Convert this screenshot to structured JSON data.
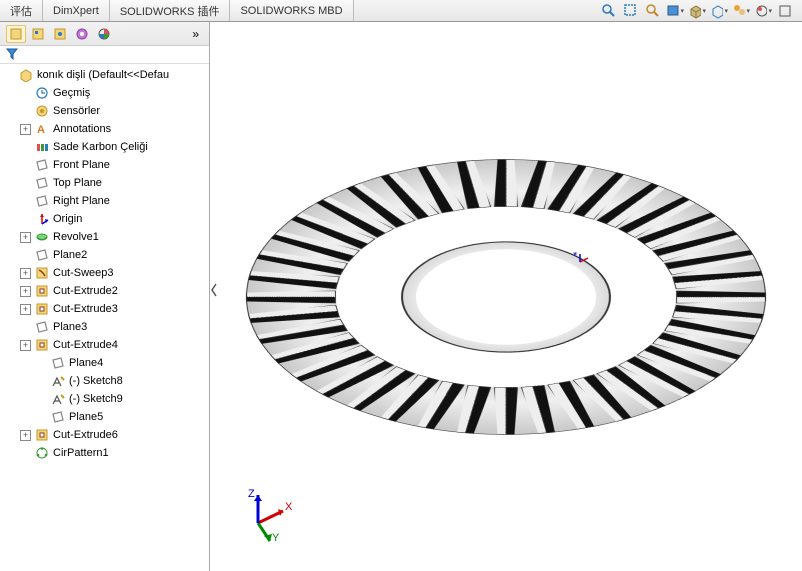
{
  "tabs": [
    "评估",
    "DimXpert",
    "SOLIDWORKS 插件",
    "SOLIDWORKS MBD"
  ],
  "toolbar_icons": [
    "zoom-fit",
    "zoom-area",
    "zoom-prev",
    "section-view",
    "view-orient",
    "display-style",
    "hide-show",
    "scene",
    "render"
  ],
  "sidebar_tab_icons": [
    "feature-tree",
    "property-mgr",
    "config-mgr",
    "dimxpert-mgr",
    "display-mgr"
  ],
  "root_label": "konık dişli  (Default<<Defau",
  "tree": [
    {
      "icon": "history",
      "label": "Geçmiş",
      "exp": "none",
      "indent": 1
    },
    {
      "icon": "sensors",
      "label": "Sensörler",
      "exp": "none",
      "indent": 1
    },
    {
      "icon": "annotations",
      "label": "Annotations",
      "exp": "plus",
      "indent": 1
    },
    {
      "icon": "material",
      "label": "Sade Karbon Çeliği",
      "exp": "none",
      "indent": 1
    },
    {
      "icon": "plane",
      "label": "Front Plane",
      "exp": "none",
      "indent": 1
    },
    {
      "icon": "plane",
      "label": "Top Plane",
      "exp": "none",
      "indent": 1
    },
    {
      "icon": "plane",
      "label": "Right Plane",
      "exp": "none",
      "indent": 1
    },
    {
      "icon": "origin",
      "label": "Origin",
      "exp": "none",
      "indent": 1
    },
    {
      "icon": "revolve",
      "label": "Revolve1",
      "exp": "plus",
      "indent": 1
    },
    {
      "icon": "plane",
      "label": "Plane2",
      "exp": "none",
      "indent": 1
    },
    {
      "icon": "cutsweep",
      "label": "Cut-Sweep3",
      "exp": "plus",
      "indent": 1
    },
    {
      "icon": "cutextrude",
      "label": "Cut-Extrude2",
      "exp": "plus",
      "indent": 1
    },
    {
      "icon": "cutextrude",
      "label": "Cut-Extrude3",
      "exp": "plus",
      "indent": 1
    },
    {
      "icon": "plane",
      "label": "Plane3",
      "exp": "none",
      "indent": 1
    },
    {
      "icon": "cutextrude",
      "label": "Cut-Extrude4",
      "exp": "plus",
      "indent": 1
    },
    {
      "icon": "plane",
      "label": "Plane4",
      "exp": "none",
      "indent": 2
    },
    {
      "icon": "sketch",
      "label": "(-) Sketch8",
      "exp": "none",
      "indent": 2
    },
    {
      "icon": "sketch",
      "label": "(-) Sketch9",
      "exp": "none",
      "indent": 2
    },
    {
      "icon": "plane",
      "label": "Plane5",
      "exp": "none",
      "indent": 2
    },
    {
      "icon": "cutextrude",
      "label": "Cut-Extrude6",
      "exp": "plus",
      "indent": 1
    },
    {
      "icon": "cirpattern",
      "label": "CirPattern1",
      "exp": "none",
      "indent": 1
    }
  ],
  "triad_labels": {
    "x": "X",
    "y": "Y",
    "z": "Z"
  },
  "gear_teeth_count": 40
}
